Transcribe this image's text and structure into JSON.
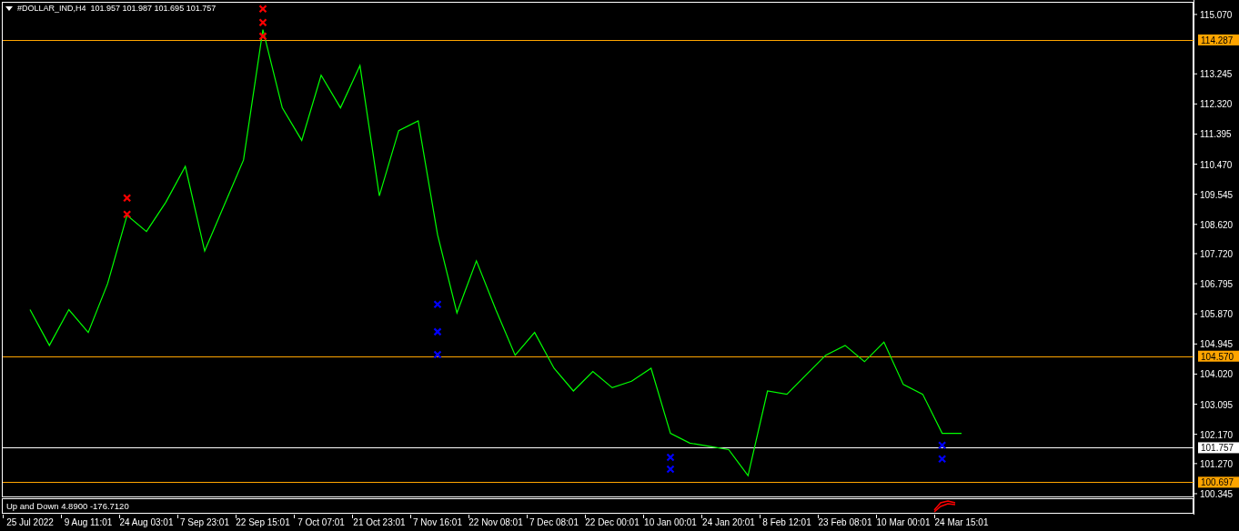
{
  "header": {
    "quote": "101.957 101.987 101.695 101.757"
  },
  "chart_data": {
    "type": "line",
    "ylim": [
      100.26,
      115.43
    ],
    "categories": [
      "25 Jul 2022",
      null,
      null,
      "9 Aug 11:01",
      null,
      null,
      "24 Aug 03:01",
      null,
      null,
      "7 Sep 23:01",
      null,
      null,
      "22 Sep 15:01",
      null,
      null,
      "7 Oct 07:01",
      null,
      null,
      "21 Oct 23:01",
      null,
      null,
      "7 Nov 16:01",
      null,
      null,
      "22 Nov 08:01",
      null,
      null,
      "7 Dec 08:01",
      null,
      null,
      "22 Dec 00:01",
      null,
      null,
      "10 Jan 00:01",
      null,
      null,
      "24 Jan 20:01",
      null,
      null,
      "8 Feb 12:01",
      null,
      null,
      "23 Feb 08:01",
      null,
      null,
      "10 Mar 00:01",
      null,
      null,
      "24 Mar 15:01",
      null
    ],
    "series": [
      {
        "name": "#DOLLAR_IND,H4",
        "color": "#00ff00",
        "values": [
          106.0,
          104.9,
          106.0,
          105.3,
          106.8,
          108.9,
          108.4,
          109.3,
          110.4,
          107.8,
          109.2,
          110.6,
          114.6,
          112.2,
          111.2,
          113.2,
          112.2,
          113.5,
          109.5,
          111.5,
          111.8,
          108.3,
          105.9,
          107.5,
          106.0,
          104.6,
          105.3,
          104.2,
          103.5,
          104.1,
          103.6,
          103.8,
          104.2,
          102.2,
          101.9,
          101.8,
          101.7,
          100.9,
          103.5,
          103.4,
          104.0,
          104.6,
          104.9,
          104.4,
          105.0,
          103.7,
          103.4,
          102.2,
          102.2,
          null
        ]
      },
      {
        "color": "#ff0000",
        "marker": "x",
        "values": [
          null,
          null,
          null,
          null,
          null,
          109.43,
          null,
          null,
          null,
          null,
          null,
          null,
          114.82,
          null,
          null,
          null,
          null,
          null,
          null,
          null,
          null,
          null,
          null,
          null,
          null,
          null,
          null,
          null,
          null,
          null,
          null,
          null,
          null,
          null,
          null,
          null,
          null,
          null,
          null,
          null,
          null,
          null,
          null,
          null,
          null,
          null,
          null,
          null,
          null,
          null
        ]
      },
      {
        "color": "#ff0000",
        "marker": "x",
        "values": [
          null,
          null,
          null,
          null,
          null,
          108.93,
          null,
          null,
          null,
          null,
          null,
          null,
          115.24,
          null,
          null,
          null,
          null,
          null,
          null,
          null,
          null,
          null,
          null,
          null,
          null,
          null,
          null,
          null,
          null,
          null,
          null,
          null,
          null,
          null,
          null,
          null,
          null,
          null,
          null,
          null,
          null,
          null,
          null,
          null,
          null,
          null,
          null,
          null,
          null,
          null
        ]
      },
      {
        "color": "#ff0000",
        "marker": "x",
        "values": [
          null,
          null,
          null,
          null,
          null,
          null,
          null,
          null,
          null,
          null,
          null,
          null,
          114.4,
          null,
          null,
          null,
          null,
          null,
          null,
          null,
          null,
          null,
          null,
          null,
          null,
          null,
          null,
          null,
          null,
          null,
          null,
          null,
          null,
          null,
          null,
          null,
          null,
          null,
          null,
          null,
          null,
          null,
          null,
          null,
          null,
          null,
          null,
          null,
          null,
          null
        ]
      },
      {
        "color": "#0000ff",
        "marker": "x",
        "values": [
          null,
          null,
          null,
          null,
          null,
          null,
          null,
          null,
          null,
          null,
          null,
          null,
          null,
          null,
          null,
          null,
          null,
          null,
          null,
          null,
          null,
          106.16,
          null,
          null,
          null,
          null,
          null,
          null,
          null,
          null,
          null,
          null,
          null,
          101.46,
          null,
          null,
          null,
          null,
          null,
          null,
          null,
          null,
          null,
          null,
          null,
          null,
          null,
          101.83,
          null,
          null
        ]
      },
      {
        "color": "#0000ff",
        "marker": "x",
        "values": [
          null,
          null,
          null,
          null,
          null,
          null,
          null,
          null,
          null,
          null,
          null,
          null,
          null,
          null,
          null,
          null,
          null,
          null,
          null,
          null,
          null,
          105.32,
          null,
          null,
          null,
          null,
          null,
          null,
          null,
          null,
          null,
          null,
          null,
          101.1,
          null,
          null,
          null,
          null,
          null,
          null,
          null,
          null,
          null,
          null,
          null,
          null,
          null,
          101.41,
          null,
          null
        ]
      },
      {
        "color": "#0000ff",
        "marker": "x",
        "values": [
          null,
          null,
          null,
          null,
          null,
          null,
          null,
          null,
          null,
          null,
          null,
          null,
          null,
          null,
          null,
          null,
          null,
          null,
          null,
          null,
          null,
          104.62,
          null,
          null,
          null,
          null,
          null,
          null,
          null,
          null,
          null,
          null,
          null,
          null,
          null,
          null,
          null,
          null,
          null,
          null,
          null,
          null,
          null,
          null,
          null,
          null,
          null,
          null,
          null,
          null
        ]
      }
    ],
    "yticks": [
      {
        "value": 115.07,
        "label": "115.070"
      },
      {
        "value": 113.245,
        "label": "113.245"
      },
      {
        "value": 112.32,
        "label": "112.320"
      },
      {
        "value": 111.395,
        "label": "111.395"
      },
      {
        "value": 110.47,
        "label": "110.470"
      },
      {
        "value": 109.545,
        "label": "109.545"
      },
      {
        "value": 108.62,
        "label": "108.620"
      },
      {
        "value": 107.72,
        "label": "107.720"
      },
      {
        "value": 106.795,
        "label": "106.795"
      },
      {
        "value": 105.87,
        "label": "105.870"
      },
      {
        "value": 104.945,
        "label": "104.945"
      },
      {
        "value": 104.02,
        "label": "104.020"
      },
      {
        "value": 103.095,
        "label": "103.095"
      },
      {
        "value": 102.17,
        "label": "102.170"
      },
      {
        "value": 101.27,
        "label": "101.270"
      },
      {
        "value": 100.345,
        "label": "100.345"
      }
    ],
    "ref_lines": [
      {
        "axis": "y",
        "value": 114.287,
        "label": "114.287",
        "color": "#ffa500"
      },
      {
        "axis": "y",
        "value": 104.57,
        "label": "104.570",
        "color": "#ffa500"
      },
      {
        "axis": "y",
        "value": 101.757,
        "label": "101.757",
        "color": "#ffffff"
      },
      {
        "axis": "y",
        "value": 100.697,
        "label": "100.697",
        "color": "#ffa500"
      }
    ]
  },
  "indicator": {
    "label": "Up and Down 4.8900 -176.7120"
  }
}
